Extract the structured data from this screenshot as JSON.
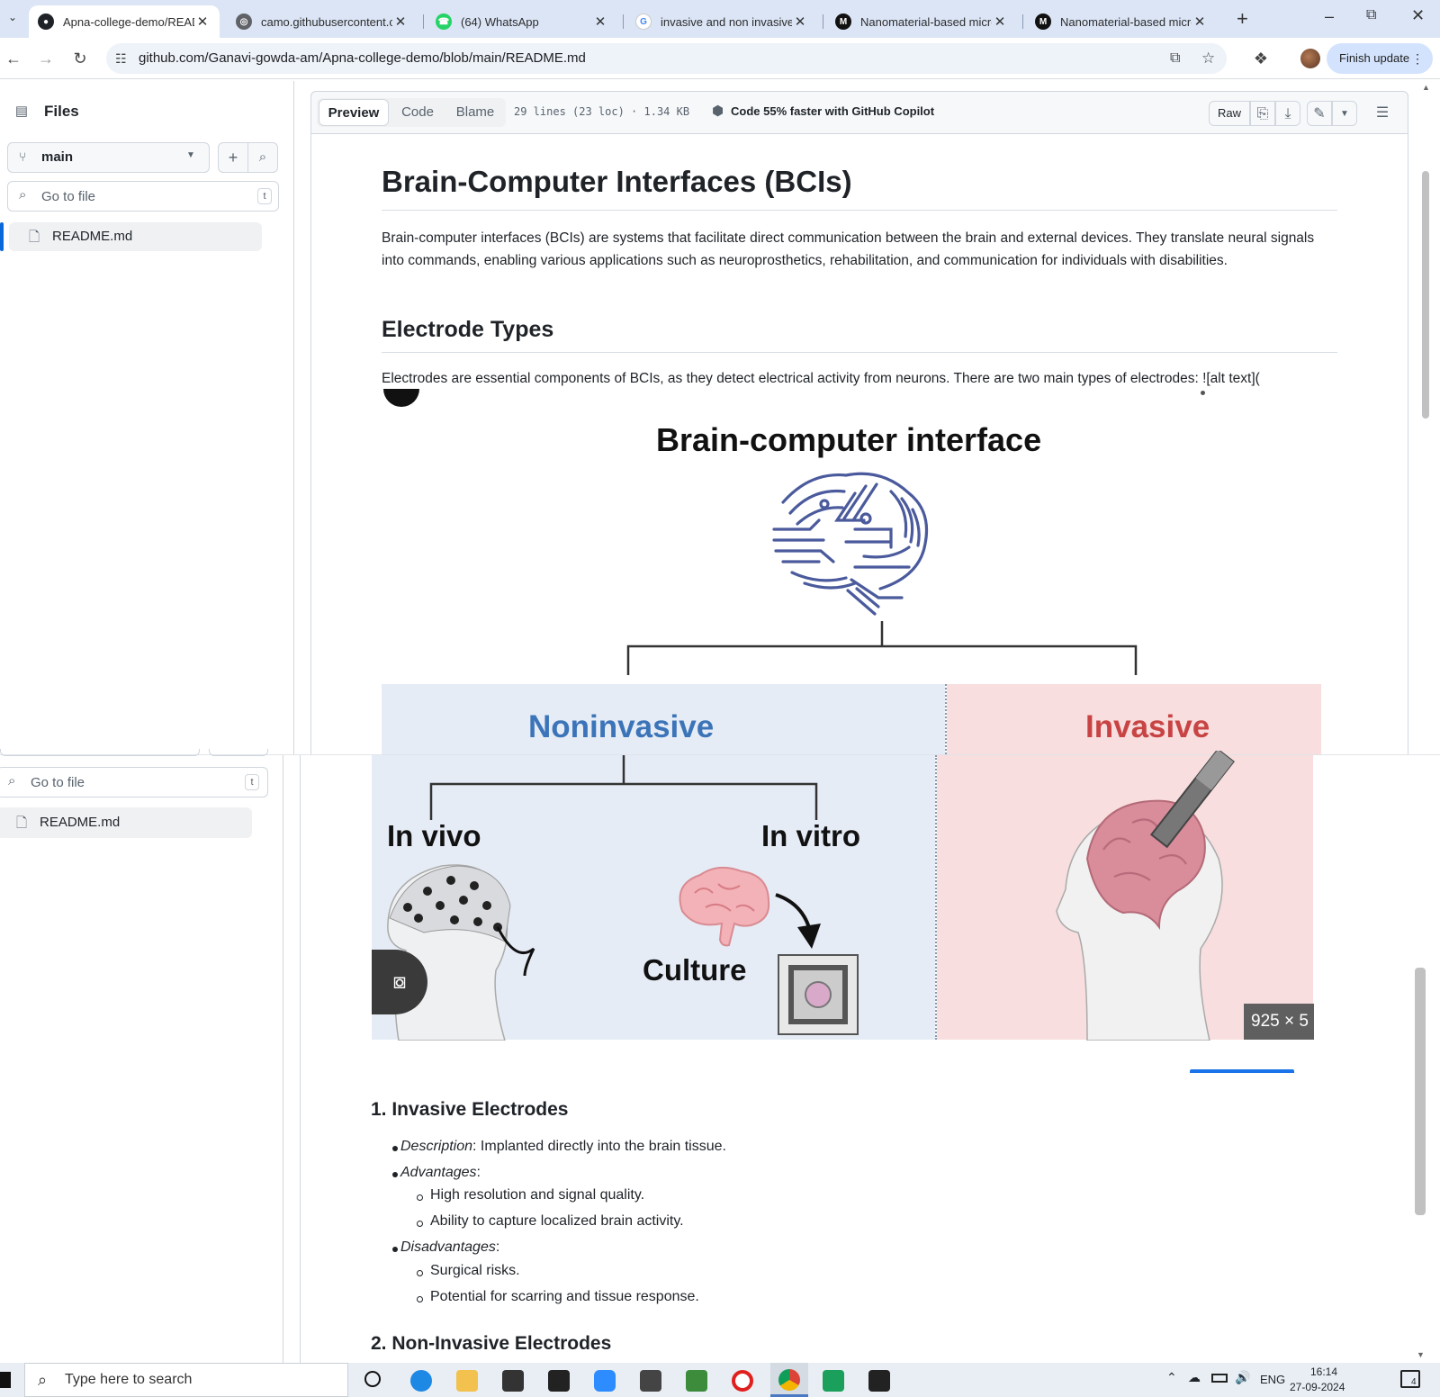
{
  "browser": {
    "tabs": [
      {
        "title": "Apna-college-demo/READ",
        "active": true,
        "icon": "github-icon"
      },
      {
        "title": "camo.githubusercontent.c",
        "active": false,
        "icon": "globe-icon"
      },
      {
        "title": "(64) WhatsApp",
        "active": false,
        "icon": "whatsapp-icon"
      },
      {
        "title": "invasive and non invasive",
        "active": false,
        "icon": "google-icon"
      },
      {
        "title": "Nanomaterial-based micro",
        "active": false,
        "icon": "site-icon"
      },
      {
        "title": "Nanomaterial-based micro",
        "active": false,
        "icon": "site-icon"
      }
    ],
    "new_tab": "+",
    "url": "github.com/Ganavi-gowda-am/Apna-college-demo/blob/main/README.md",
    "finish_update": "Finish update"
  },
  "sidebar": {
    "title": "Files",
    "branch": "main",
    "search_placeholder": "Go to file",
    "search_kbd": "t",
    "files": [
      "README.md"
    ]
  },
  "file_header": {
    "tabs": [
      "Preview",
      "Code",
      "Blame"
    ],
    "meta": "29 lines (23 loc) · 1.34 KB",
    "copilot": "Code 55% faster with GitHub Copilot",
    "raw": "Raw"
  },
  "readme": {
    "h1": "Brain-Computer Interfaces (BCIs)",
    "intro": "Brain-computer interfaces (BCIs) are systems that facilitate direct communication between the brain and external devices. They translate neural signals into commands, enabling various applications such as neuroprosthetics, rehabilitation, and communication for individuals with disabilities.",
    "h2": "Electrode Types",
    "electrodes_p": "Electrodes are essential components of BCIs, as they detect electrical activity from neurons. There are two main types of electrodes: ![alt text](",
    "figure": {
      "title": "Brain-computer interface",
      "left": "Noninvasive",
      "right": "Invasive",
      "in_vivo": "In vivo",
      "in_vitro": "In vitro",
      "culture": "Culture",
      "size_badge": "925 × 5"
    },
    "section1": {
      "heading": "1. Invasive Electrodes",
      "desc_label": "Description",
      "desc": ": Implanted directly into the brain tissue.",
      "adv_label": "Advantages",
      "adv_colon": ":",
      "advantages": [
        "High resolution and signal quality.",
        "Ability to capture localized brain activity."
      ],
      "dis_label": "Disadvantages",
      "dis_colon": ":",
      "disadvantages": [
        "Surgical risks.",
        "Potential for scarring and tissue response."
      ]
    },
    "section2": {
      "heading": "2. Non-Invasive Electrodes"
    }
  },
  "taskbar": {
    "search_placeholder": "Type here to search",
    "lang": "ENG",
    "time": "16:14",
    "date": "27-09-2024",
    "notif_count": "4"
  }
}
